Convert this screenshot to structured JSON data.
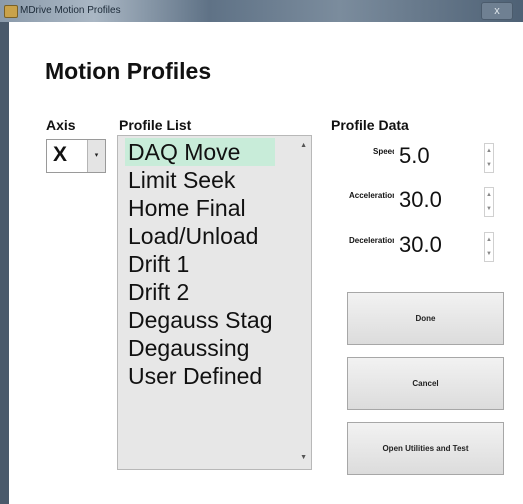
{
  "window": {
    "title": "MDrive Motion Profiles",
    "close_label": "x"
  },
  "heading": "Motion Profiles",
  "axis": {
    "label": "Axis",
    "value": "X",
    "arrow": "▾"
  },
  "profile_list": {
    "label": "Profile List",
    "items": [
      "DAQ Move",
      "Limit Seek",
      "Home Final",
      "Load/Unload",
      "Drift 1",
      "Drift 2",
      "Degauss Stag",
      "Degaussing",
      "User Defined"
    ],
    "selected_index": 0
  },
  "profile_data": {
    "label": "Profile Data",
    "speed": {
      "label": "Speed",
      "value": "5.0"
    },
    "acceleration": {
      "label": "Acceleration",
      "value": "30.0"
    },
    "deceleration": {
      "label": "Deceleration",
      "value": "30.0"
    }
  },
  "buttons": {
    "done": "Done",
    "cancel": "Cancel",
    "utilities": "Open Utilities and Test"
  },
  "glyphs": {
    "up": "▲",
    "down": "▼"
  }
}
